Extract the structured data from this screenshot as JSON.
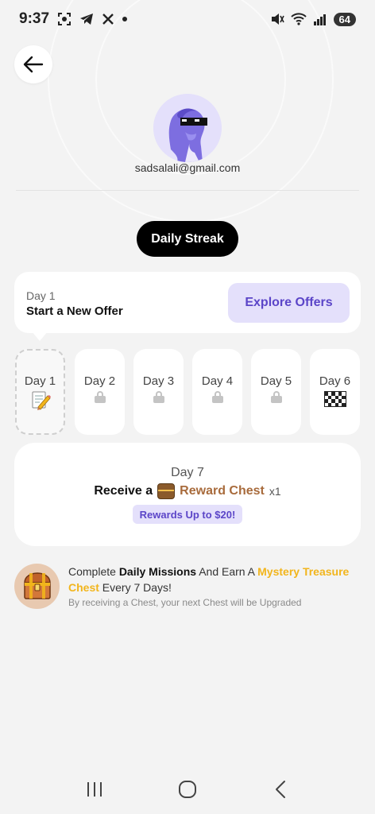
{
  "status_bar": {
    "time": "9:37",
    "battery": "64"
  },
  "profile": {
    "email": "sadsalali@gmail.com"
  },
  "streak": {
    "title": "Daily Streak"
  },
  "offer": {
    "day": "Day 1",
    "title": "Start a New Offer",
    "button": "Explore Offers"
  },
  "days": [
    {
      "label": "Day 1",
      "icon": "memo-pencil-icon",
      "state": "active"
    },
    {
      "label": "Day 2",
      "icon": "lock-icon",
      "state": "locked"
    },
    {
      "label": "Day 3",
      "icon": "lock-icon",
      "state": "locked"
    },
    {
      "label": "Day 4",
      "icon": "lock-icon",
      "state": "locked"
    },
    {
      "label": "Day 5",
      "icon": "lock-icon",
      "state": "locked"
    },
    {
      "label": "Day 6",
      "icon": "checkered-flag-icon",
      "state": "locked"
    }
  ],
  "day7": {
    "title": "Day 7",
    "receive": "Receive a",
    "reward": "Reward Chest",
    "count": "x1",
    "badge": "Rewards Up to $20!"
  },
  "mission": {
    "part1": "Complete ",
    "part2": "Daily Missions",
    "part3": " And Earn A ",
    "part4": "Mystery Treasure Chest",
    "part5": " Every 7 Days!",
    "sub": "By receiving a Chest, your next Chest will be Upgraded"
  },
  "colors": {
    "accent": "#5b45c8",
    "accent_bg": "#e4e0fb",
    "gold": "#f2b51c",
    "reward_brown": "#a86b3c"
  }
}
